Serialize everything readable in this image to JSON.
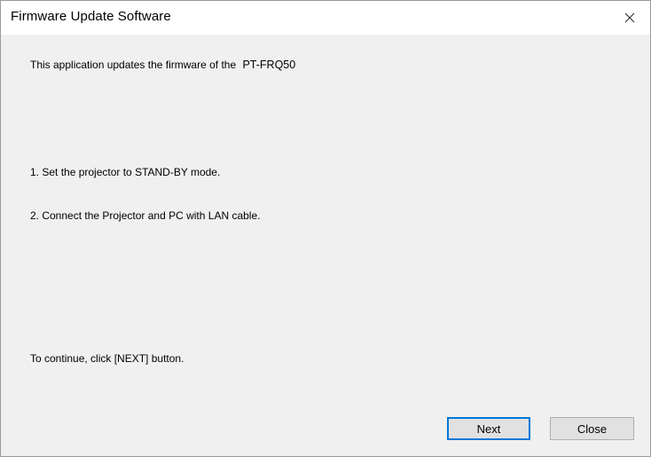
{
  "window": {
    "title": "Firmware Update Software",
    "close_icon": "close-icon"
  },
  "content": {
    "intro_text": "This application updates the firmware of the",
    "intro_model": "PT-FRQ50",
    "step1": "1. Set the projector to STAND-BY mode.",
    "step2": "2. Connect the Projector and PC with LAN cable.",
    "continue_text": "To continue, click [NEXT] button."
  },
  "buttons": {
    "next_label": "Next",
    "close_label": "Close"
  },
  "colors": {
    "accent": "#0078d7",
    "background": "#f0f0f0",
    "titlebar": "#ffffff"
  }
}
